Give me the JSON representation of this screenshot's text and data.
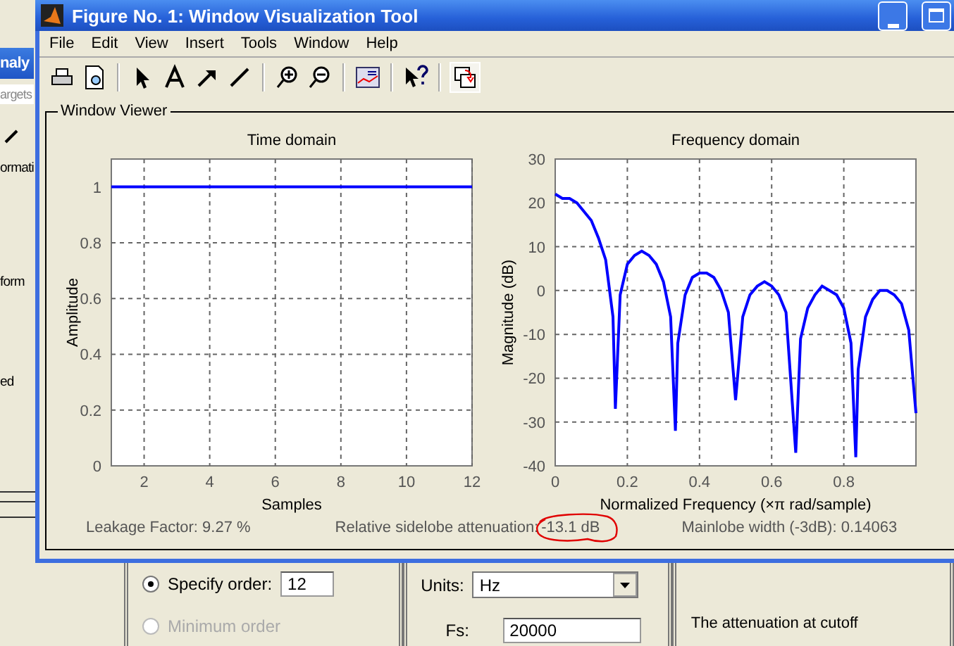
{
  "background_app": {
    "title": "naly",
    "field_value": "argets",
    "texts": [
      "ormati",
      "form",
      "ed"
    ],
    "order": {
      "options": [
        {
          "label": "Specify order:",
          "selected": true,
          "disabled": false
        },
        {
          "label": "Minimum order",
          "selected": false,
          "disabled": true
        }
      ],
      "value": "12"
    },
    "units": {
      "label": "Units:",
      "value": "Hz"
    },
    "fs": {
      "label": "Fs:",
      "value": "20000"
    },
    "note": "The attenuation at cutoff"
  },
  "window": {
    "title": "Figure No. 1: Window Visualization Tool"
  },
  "menu": [
    "File",
    "Edit",
    "View",
    "Insert",
    "Tools",
    "Window",
    "Help"
  ],
  "viewer": {
    "title": "Window Viewer",
    "time_plot": {
      "chart_data": {
        "type": "line",
        "grid": true,
        "title": "Time domain",
        "xlabel": "Samples",
        "ylabel": "Amplitude",
        "x": [
          1,
          12
        ],
        "xlim": [
          1,
          12
        ],
        "ylim": [
          0,
          1.1
        ],
        "xticks": [
          2,
          4,
          6,
          8,
          10,
          12
        ],
        "yticks": [
          0,
          0.2,
          0.4,
          0.6,
          0.8,
          1
        ],
        "series": [
          {
            "color": "#0000ff",
            "values": [
              1,
              1
            ]
          }
        ]
      }
    },
    "freq_plot": {
      "chart_data": {
        "type": "line",
        "grid": true,
        "title": "Frequency domain",
        "xlabel": "Normalized Frequency  (×π rad/sample)",
        "ylabel": "Magnitude (dB)",
        "xlim": [
          0,
          1
        ],
        "ylim": [
          -40,
          30
        ],
        "xticks": [
          0,
          0.2,
          0.4,
          0.6,
          0.8
        ],
        "yticks": [
          -40,
          -30,
          -20,
          -10,
          0,
          10,
          20,
          30
        ],
        "x": [
          0,
          0.02,
          0.04,
          0.06,
          0.08,
          0.1,
          0.12,
          0.14,
          0.16,
          0.1667,
          0.18,
          0.2,
          0.22,
          0.24,
          0.26,
          0.28,
          0.3,
          0.32,
          0.3333,
          0.34,
          0.36,
          0.38,
          0.4,
          0.42,
          0.44,
          0.46,
          0.48,
          0.5,
          0.52,
          0.54,
          0.56,
          0.58,
          0.6,
          0.62,
          0.64,
          0.6667,
          0.68,
          0.7,
          0.72,
          0.74,
          0.76,
          0.78,
          0.8,
          0.82,
          0.8333,
          0.84,
          0.86,
          0.88,
          0.9,
          0.92,
          0.94,
          0.96,
          0.98,
          1
        ],
        "series": [
          {
            "color": "#0000ff",
            "values": [
              22,
              21,
              21,
              20,
              18,
              16,
              12,
              7,
              -6,
              -27,
              -1,
              6,
              8,
              9,
              8,
              6,
              2,
              -6,
              -32,
              -12,
              -1,
              3,
              4,
              4,
              3,
              0,
              -5,
              -25,
              -6,
              -1,
              1,
              2,
              1,
              -1,
              -5,
              -37,
              -11,
              -4,
              -1,
              1,
              0,
              -1,
              -4,
              -12,
              -38,
              -18,
              -6,
              -2,
              0,
              0,
              -1,
              -3,
              -9,
              -28
            ]
          }
        ]
      }
    },
    "leakage": "Leakage Factor: 9.27 %",
    "sidelobe_label": "Relative sidelobe attenuation:",
    "sidelobe_value": "-13.1 dB",
    "mainlobe": "Mainlobe width (-3dB): 0.14063"
  }
}
